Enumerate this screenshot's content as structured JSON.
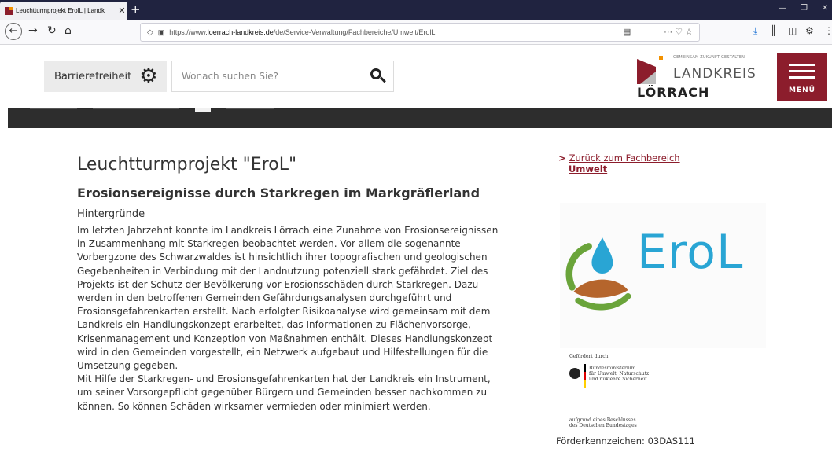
{
  "browser": {
    "tab_title": "Leuchtturmprojekt ErolL | Landk",
    "tab_close": "✕",
    "new_tab": "+",
    "url_prefix": "https://www.",
    "url_domain": "loerrach-landkreis.de",
    "url_path": "/de/Service-Verwaltung/Fachbereiche/Umwelt/ErolL",
    "url_icons": "··· ♡ ☆",
    "icons": [
      "back-arrow-icon",
      "forward-arrow-icon",
      "reload-icon",
      "home-icon",
      "shield-icon",
      "lock-icon",
      "reader-icon",
      "download-icon",
      "library-icon",
      "sidebar-icon",
      "extension-icon",
      "overflow-menu-icon"
    ]
  },
  "header": {
    "accessibility_label": "Barrierefreiheit",
    "search_placeholder": "Wonach suchen Sie?",
    "logo_tagline": "GEMEINSAM ZUKUNFT GESTALTEN",
    "logo_line1": "LANDKREIS",
    "logo_line2": "LÖRRACH",
    "menu_label": "MENÜ"
  },
  "main": {
    "title": "Leuchtturmprojekt \"EroL\"",
    "subtitle": "Erosionsereignisse durch Starkregen im Markgräflerland",
    "section_heading": "Hintergründe",
    "paragraph1": "Im letzten Jahrzehnt konnte im Landkreis Lörrach eine Zunahme von Erosionsereignissen in Zusammenhang mit Starkregen beobachtet werden. Vor allem die sogenannte Vorbergzone des Schwarzwaldes ist hinsichtlich ihrer topografischen und geologischen Gegebenheiten in Verbindung mit der Landnutzung potenziell stark gefährdet. Ziel des Projekts ist der Schutz der Bevölkerung vor Erosionsschäden durch Starkregen. Dazu werden in den betroffenen Gemeinden Gefährdungsanalysen durchgeführt und Erosionsgefahrenkarten erstellt. Nach erfolgter Risikoanalyse wird gemeinsam mit dem Landkreis ein Handlungskonzept erarbeitet, das Informationen zu Flächenvorsorge, Krisenmanagement und Konzeption von Maßnahmen enthält. Dieses Handlungskonzept wird in den Gemeinden vorgestellt, ein Netzwerk aufgebaut und Hilfestellungen für die Umsetzung gegeben.",
    "paragraph2": "Mit Hilfe der Starkregen- und Erosionsgefahrenkarten hat der Landkreis ein Instrument, um seiner Vorsorgepflicht gegenüber Bürgern und Gemeinden besser nachkommen zu können. So können Schäden wirksamer vermieden oder minimiert werden."
  },
  "sidebar": {
    "back_link_chevron": ">",
    "back_link_text": "Zurück zum Fachbereich",
    "back_link_target": "Umwelt",
    "erol_logo_text": "EroL",
    "funded_by": "Gefördert durch:",
    "ministry_lines": [
      "Bundesministerium",
      "für Umwelt, Naturschutz",
      "und nukleare Sicherheit"
    ],
    "decision_lines": [
      "aufgrund eines Beschlusses",
      "des Deutschen Bundestages"
    ],
    "funding_id": "Förderkennzeichen: 03DAS111"
  },
  "colors": {
    "brand_red": "#8c1d2c",
    "brand_orange": "#f29100",
    "erol_blue": "#29a5d4",
    "erol_green": "#6aa43a",
    "erol_brown": "#b5652c"
  }
}
